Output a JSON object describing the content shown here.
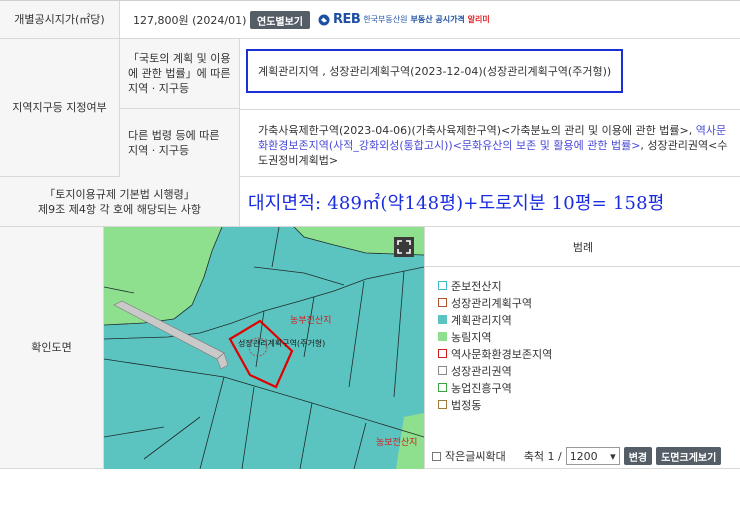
{
  "land_price": {
    "label": "개별공시지가(㎡당)",
    "value": "127,800원 (2024/01)",
    "yearly_button": "연도별보기",
    "reb_logo": "REB",
    "reb_org": "한국부동산원",
    "reb_link_prefix": "부동산 공시가격",
    "reb_link_suffix": "알리미"
  },
  "zoning": {
    "label": "지역지구등 지정여부",
    "national_law_label": "「국토의 계획 및 이용\n에 관한 법률」에 따른\n지역 · 지구등",
    "national_law_value": "계획관리지역 , 성장관리계획구역(2023-12-04)(성장관리계획구역(주거형))",
    "other_law_label": "다른 법령 등에 따른\n지역 · 지구등",
    "other_law_part1": "가축사육제한구역(2023-04-06)(가축사육제한구역)<가축분뇨의 관리 및 이용에 관한 법률>,",
    "other_law_link": "역사문화환경보존지역(사적_강화외성(통합고시))<문화유산의 보존 및 활용에 관한 법률>",
    "other_law_part2": ", 성장관리권역<수도권정비계획법>"
  },
  "regulation": {
    "label_line1": "「토지이용규제 기본법 시행령」",
    "label_line2": "제9조 제4항 각 호에 해당되는 사항",
    "area_note": "대지면적: 489㎡(약148평)+도로지분 10평= 158평"
  },
  "map": {
    "label": "확인도면",
    "text_top": "농부전산지",
    "text_parcel": "성장관리계획구역(주거형)",
    "text_bottom": "농보전산지"
  },
  "legend": {
    "title": "범례",
    "items": [
      {
        "label": "준보전산지",
        "color": "#3fb8c9",
        "filled": false
      },
      {
        "label": "성장관리계획구역",
        "color": "#b0522b",
        "filled": false
      },
      {
        "label": "계획관리지역",
        "color": "#5cc4c0",
        "filled": true
      },
      {
        "label": "농림지역",
        "color": "#8ee08e",
        "filled": true
      },
      {
        "label": "역사문화환경보존지역",
        "color": "#d61f1f",
        "filled": false
      },
      {
        "label": "성장관리권역",
        "color": "#888888",
        "filled": false
      },
      {
        "label": "농업진흥구역",
        "color": "#3aa33a",
        "filled": false
      },
      {
        "label": "법정동",
        "color": "#9b7a3c",
        "filled": false
      }
    ],
    "small_text_label": "작은글씨확대",
    "scale_label": "축척 1 /",
    "scale_value": "1200",
    "change_button": "변경",
    "enlarge_button": "도면크게보기"
  }
}
